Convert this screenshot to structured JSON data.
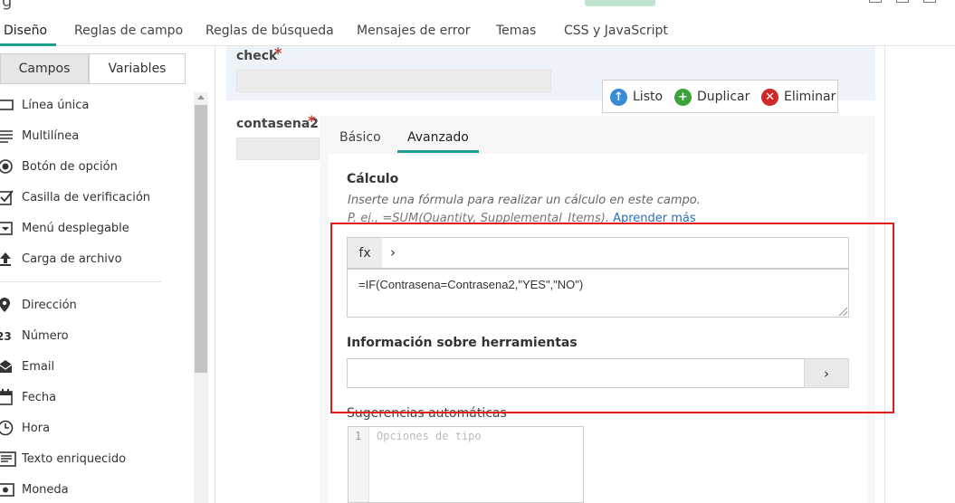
{
  "top": {
    "partial_char": "g"
  },
  "tabs": [
    {
      "label": "Diseño",
      "active": true
    },
    {
      "label": "Reglas de campo"
    },
    {
      "label": "Reglas de búsqueda"
    },
    {
      "label": "Mensajes de error"
    },
    {
      "label": "Temas"
    },
    {
      "label": "CSS y JavaScript"
    }
  ],
  "sidebar": {
    "toggle": {
      "fields_label": "Campos",
      "variables_label": "Variables"
    },
    "items": [
      {
        "label": "Línea única",
        "icon": "single-line-icon"
      },
      {
        "label": "Multilínea",
        "icon": "multiline-icon"
      },
      {
        "label": "Botón de opción",
        "icon": "radio-icon"
      },
      {
        "label": "Casilla de verificación",
        "icon": "checkbox-icon"
      },
      {
        "label": "Menú desplegable",
        "icon": "dropdown-icon"
      },
      {
        "label": "Carga de archivo",
        "icon": "upload-icon"
      },
      {
        "label": "Dirección",
        "icon": "location-pin-icon"
      },
      {
        "label": "Número",
        "icon": "number-icon"
      },
      {
        "label": "Email",
        "icon": "envelope-icon"
      },
      {
        "label": "Fecha",
        "icon": "calendar-icon"
      },
      {
        "label": "Hora",
        "icon": "clock-icon"
      },
      {
        "label": "Texto enriquecido",
        "icon": "rich-text-icon"
      },
      {
        "label": "Moneda",
        "icon": "currency-icon"
      }
    ]
  },
  "canvas": {
    "field_check": {
      "label": "check",
      "required_mark": "*"
    },
    "field_contasena2": {
      "label": "contasena2",
      "required_mark": "*"
    },
    "toolbar": {
      "done_label": "Listo",
      "duplicate_label": "Duplicar",
      "delete_label": "Eliminar"
    }
  },
  "properties": {
    "tabs": {
      "basic_label": "Básico",
      "advanced_label": "Avanzado"
    },
    "calc": {
      "label": "Cálculo",
      "help": "Inserte una fórmula para realizar un cálculo en este campo.",
      "example": "P. ej., =SUM(Quantity, Supplemental_Items).",
      "learn_more": "Aprender más"
    },
    "fx": {
      "button_label": "fx",
      "chevron": "›"
    },
    "formula": "=IF(Contrasena=Contrasena2,\"YES\",\"NO\")",
    "tooltip": {
      "label": "Información sobre herramientas",
      "button_chevron": "›"
    },
    "suggestions": {
      "label": "Sugerencias automáticas",
      "line_number": "1",
      "placeholder": "Opciones de tipo"
    }
  },
  "colors": {
    "accent": "#1d9e8c",
    "highlight": "#e01b1b",
    "done": "#3a8ad6",
    "duplicate": "#3aa33a",
    "delete": "#d02828"
  }
}
